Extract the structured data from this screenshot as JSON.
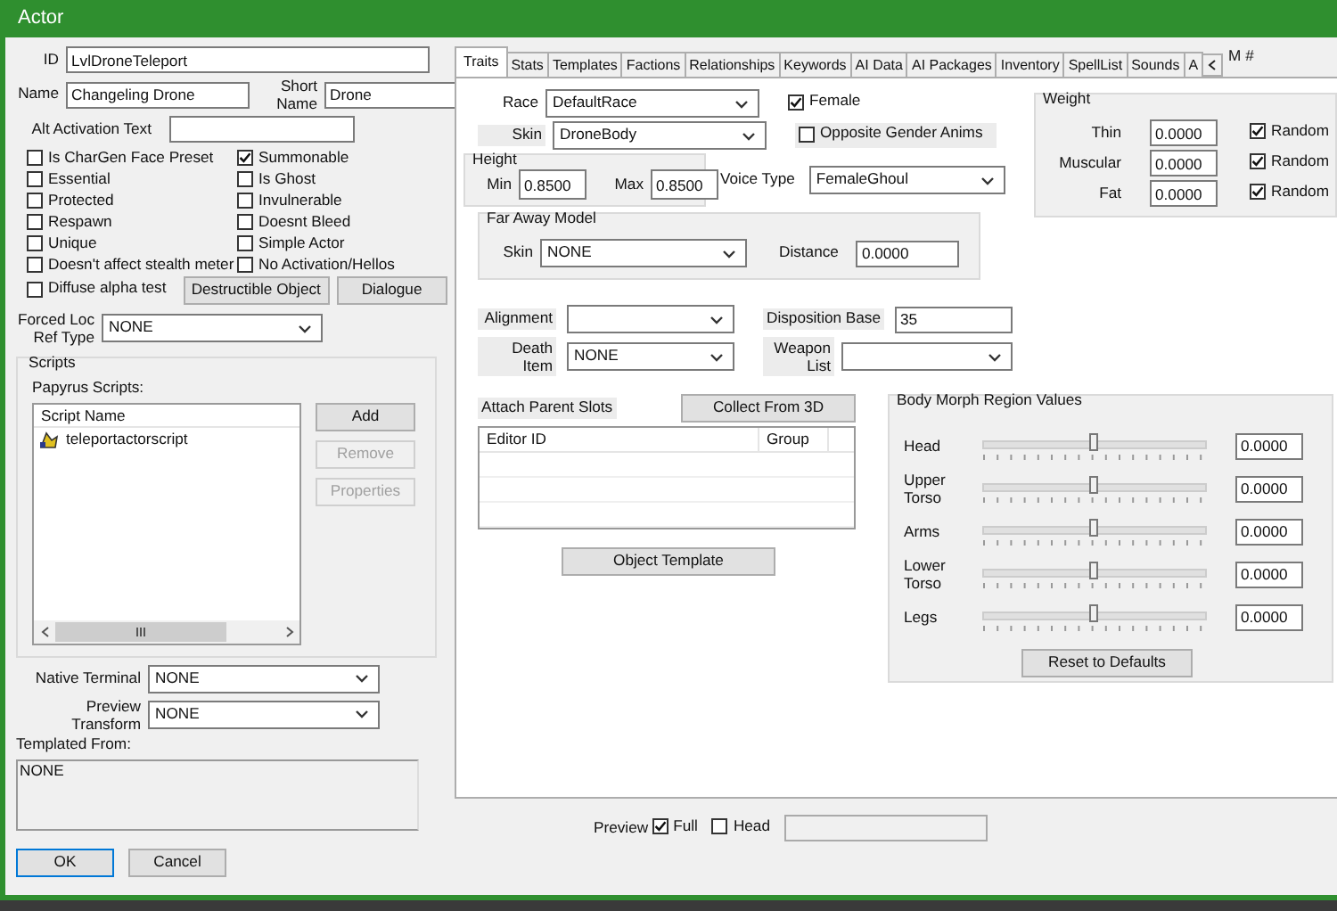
{
  "window": {
    "title": "Actor"
  },
  "left": {
    "id": {
      "label": "ID",
      "value": "LvlDroneTeleport"
    },
    "name": {
      "label": "Name",
      "value": "Changeling Drone"
    },
    "short_name": {
      "label": "Short Name",
      "value": "Drone"
    },
    "alt_activation_text": {
      "label": "Alt Activation Text"
    },
    "flags": [
      {
        "label": "Is CharGen Face Preset",
        "checked": false
      },
      {
        "label": "Summonable",
        "checked": true
      },
      {
        "label": "Essential",
        "checked": false
      },
      {
        "label": "Is Ghost",
        "checked": false
      },
      {
        "label": "Protected",
        "checked": false
      },
      {
        "label": "Invulnerable",
        "checked": false
      },
      {
        "label": "Respawn",
        "checked": false
      },
      {
        "label": "Doesnt Bleed",
        "checked": false
      },
      {
        "label": "Unique",
        "checked": false
      },
      {
        "label": "Simple Actor",
        "checked": false
      },
      {
        "label": "Doesn't affect stealth meter",
        "checked": false
      },
      {
        "label": "No Activation/Hellos",
        "checked": false
      },
      {
        "label": "Diffuse alpha test",
        "checked": false
      }
    ],
    "buttons": [
      {
        "label": "Destructible Object"
      },
      {
        "label": "Dialogue"
      }
    ],
    "forced_loc_ref_type": {
      "label": "Forced Loc Ref Type",
      "value": "NONE"
    },
    "scripts": {
      "title": "Scripts",
      "subtitle": "Papyrus Scripts:",
      "column": "Script Name",
      "items": [
        "teleportactorscript"
      ],
      "buttons": [
        {
          "label": "Add",
          "disabled": false
        },
        {
          "label": "Remove",
          "disabled": true
        },
        {
          "label": "Properties",
          "disabled": true
        }
      ]
    },
    "native_terminal": {
      "label": "Native Terminal",
      "value": "NONE"
    },
    "preview_transform": {
      "label": "Preview Transform",
      "value": "NONE"
    },
    "templated_from": {
      "label": "Templated From:",
      "value": "NONE"
    },
    "dialog_buttons": [
      {
        "label": "OK",
        "default": true
      },
      {
        "label": "Cancel",
        "default": false
      }
    ]
  },
  "tabs": [
    {
      "label": "Traits",
      "selected": true
    },
    {
      "label": "Stats",
      "selected": false
    },
    {
      "label": "Templates",
      "selected": false
    },
    {
      "label": "Factions",
      "selected": false
    },
    {
      "label": "Relationships",
      "selected": false
    },
    {
      "label": "Keywords",
      "selected": false
    },
    {
      "label": "AI Data",
      "selected": false
    },
    {
      "label": "AI Packages",
      "selected": false
    },
    {
      "label": "Inventory",
      "selected": false
    },
    {
      "label": "SpellList",
      "selected": false
    },
    {
      "label": "Sounds",
      "selected": false
    },
    {
      "label": "A",
      "selected": false
    }
  ],
  "cut_label": "M #",
  "traits": {
    "race": {
      "label": "Race",
      "value": "DefaultRace"
    },
    "skin": {
      "label": "Skin",
      "value": "DroneBody"
    },
    "female": {
      "label": "Female",
      "checked": true
    },
    "opposite_gender_anims": {
      "label": "Opposite Gender Anims",
      "checked": false
    },
    "height": {
      "title": "Height",
      "min": {
        "label": "Min",
        "value": "0.8500"
      },
      "max": {
        "label": "Max",
        "value": "0.8500"
      }
    },
    "voice_type": {
      "label": "Voice Type",
      "value": "FemaleGhoul"
    },
    "weight": {
      "title": "Weight",
      "rows": [
        {
          "label": "Thin",
          "value": "0.0000",
          "random_label": "Random",
          "random": true
        },
        {
          "label": "Muscular",
          "value": "0.0000",
          "random_label": "Random",
          "random": true
        },
        {
          "label": "Fat",
          "value": "0.0000",
          "random_label": "Random",
          "random": true
        }
      ]
    },
    "far_away_model": {
      "title": "Far Away Model",
      "skin": {
        "label": "Skin",
        "value": "NONE"
      },
      "distance": {
        "label": "Distance",
        "value": "0.0000"
      }
    },
    "alignment": {
      "label": "Alignment"
    },
    "disposition_base": {
      "label": "Disposition Base",
      "value": "35"
    },
    "death_item": {
      "label": "Death Item",
      "value": "NONE"
    },
    "weapon_list": {
      "label": "Weapon List"
    },
    "attach_parent_slots": {
      "label": "Attach Parent Slots",
      "button": "Collect From 3D",
      "columns": [
        "Editor ID",
        "Group"
      ]
    },
    "object_template_button": "Object Template",
    "body_morph": {
      "title": "Body Morph Region Values",
      "rows": [
        {
          "label": "Head",
          "level": 0.5,
          "value": "0.0000"
        },
        {
          "label": "Upper Torso",
          "level": 0.5,
          "value": "0.0000"
        },
        {
          "label": "Arms",
          "level": 0.5,
          "value": "0.0000"
        },
        {
          "label": "Lower Torso",
          "level": 0.5,
          "value": "0.0000"
        },
        {
          "label": "Legs",
          "level": 0.5,
          "value": "0.0000"
        }
      ],
      "reset_button": "Reset to Defaults"
    }
  },
  "preview": {
    "label": "Preview",
    "full": {
      "label": "Full",
      "checked": true
    },
    "head": {
      "label": "Head",
      "checked": false
    }
  }
}
